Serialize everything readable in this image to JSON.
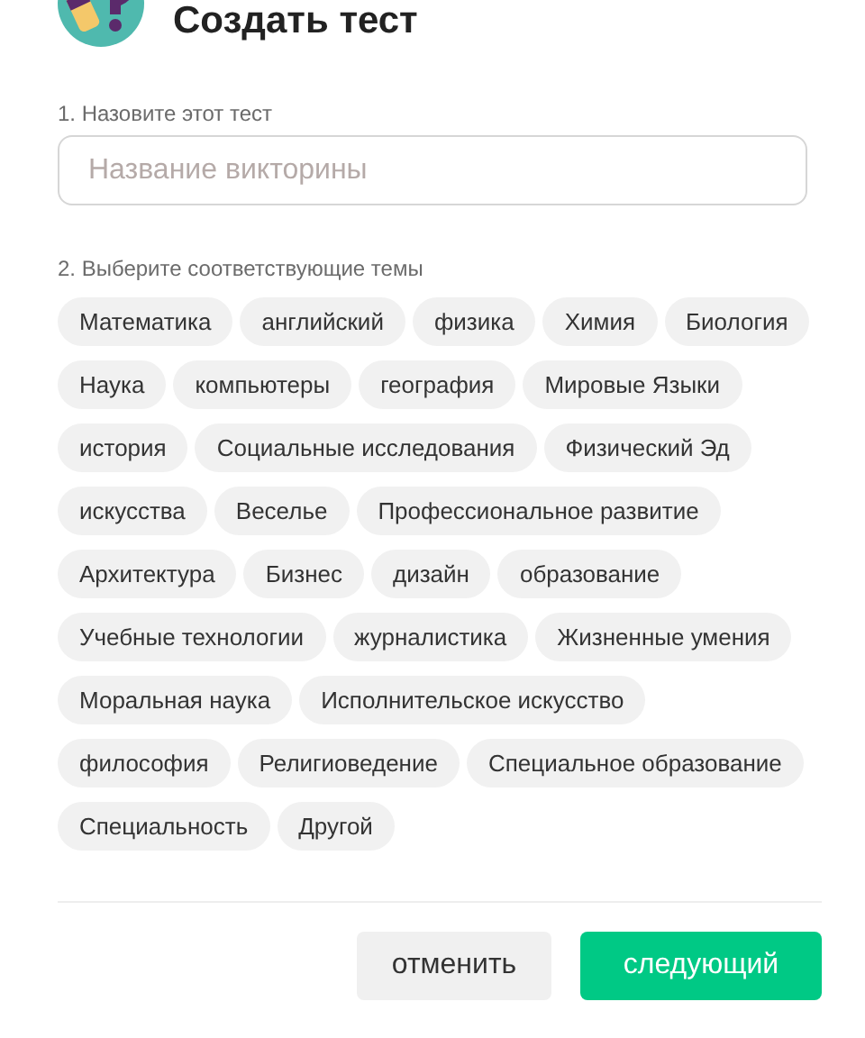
{
  "dialog": {
    "title": "Создать тест"
  },
  "name_field": {
    "label": "1. Назовите этот тест",
    "placeholder": "Название викторины"
  },
  "topics": {
    "label": "2. Выберите соответствующие темы",
    "rows": [
      [
        "Математика",
        "английский",
        "физика",
        "Химия",
        "Биология"
      ],
      [
        "Наука",
        "компьютеры",
        "география",
        "Мировые Языки"
      ],
      [
        "история",
        "Социальные исследования",
        "Физический Эд"
      ],
      [
        "искусства",
        "Веселье",
        "Профессиональное развитие"
      ],
      [
        "Архитектура",
        "Бизнес",
        "дизайн",
        "образование"
      ],
      [
        "Учебные технологии",
        "журналистика",
        "Жизненные умения"
      ],
      [
        "Моральная наука",
        "Исполнительское искусство"
      ],
      [
        "философия",
        "Религиоведение",
        "Специальное образование"
      ],
      [
        "Специальность",
        "Другой"
      ]
    ]
  },
  "buttons": [
    {
      "label": "отменить",
      "kind": "secondary"
    },
    {
      "label": "следующий",
      "kind": "primary"
    }
  ]
}
